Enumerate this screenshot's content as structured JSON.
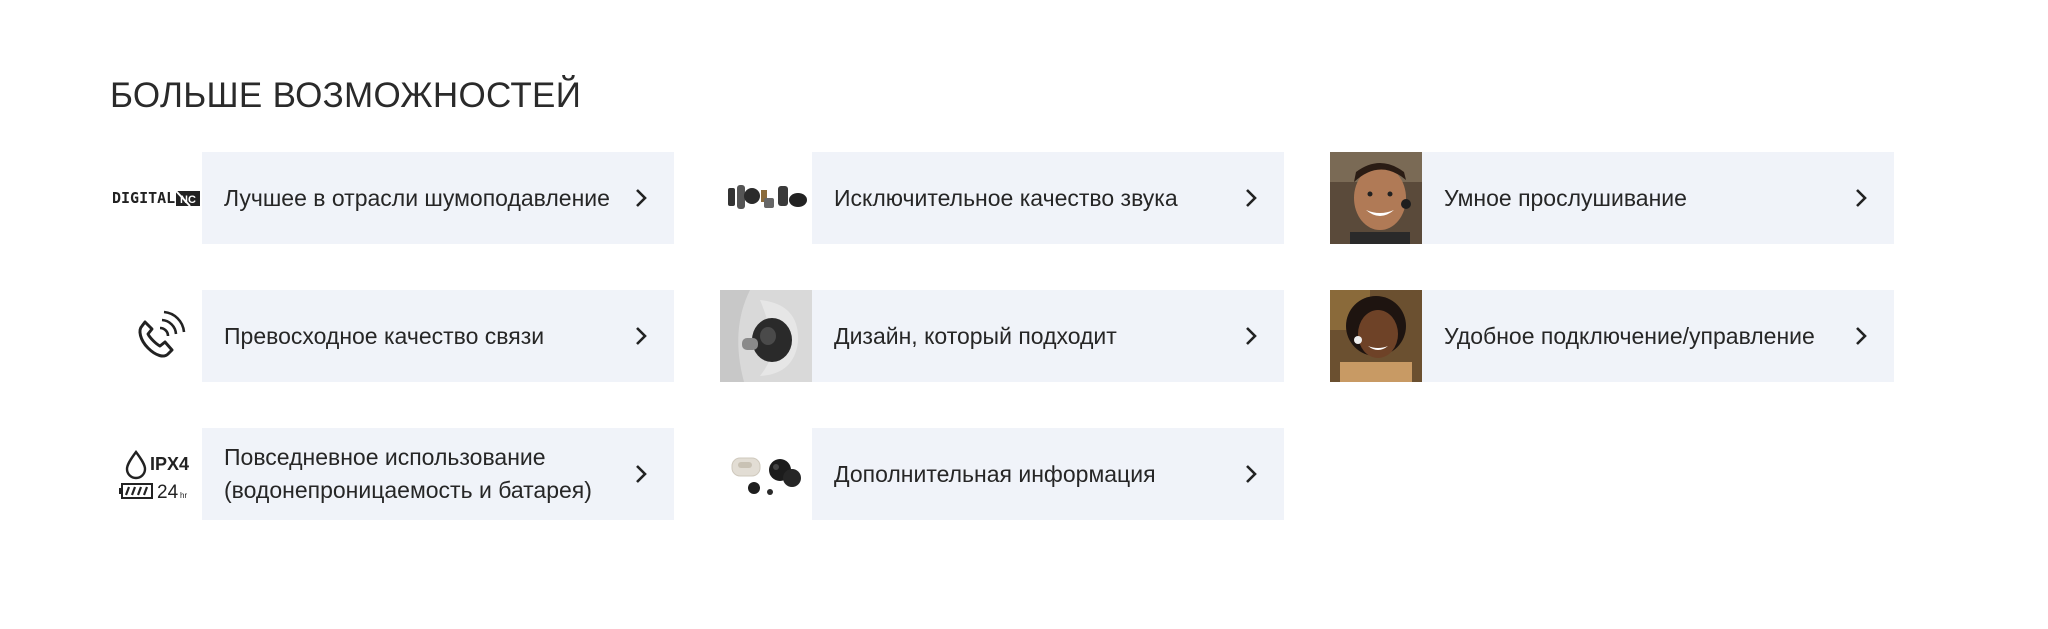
{
  "section": {
    "title": "БОЛЬШЕ ВОЗМОЖНОСТЕЙ"
  },
  "features": [
    {
      "label": "Лучшее в отрасли шумоподавление",
      "icon": "digital-nc-logo",
      "logo_text": "DIGITAL",
      "logo_badge": "NC"
    },
    {
      "label": "Исключительное качество звука",
      "icon": "earbud-components-image"
    },
    {
      "label": "Умное прослушивание",
      "icon": "smiling-man-photo"
    },
    {
      "label": "Превосходное качество связи",
      "icon": "phone-call-icon"
    },
    {
      "label": "Дизайн, который подходит",
      "icon": "earbud-in-ear-photo"
    },
    {
      "label": "Удобное подключение/управление",
      "icon": "smiling-woman-photo"
    },
    {
      "label_line1": "Повседневное использование",
      "label_line2": "(водонепроницаемость и батарея)",
      "icon": "ipx4-battery-icon",
      "ipx": "IPX4",
      "battery_hours": "24",
      "battery_unit": "hr"
    },
    {
      "label": "Дополнительная информация",
      "icon": "earbuds-case-image"
    }
  ],
  "colors": {
    "panel_bg": "#f0f3f9",
    "text": "#262626",
    "chevron": "#222222"
  }
}
